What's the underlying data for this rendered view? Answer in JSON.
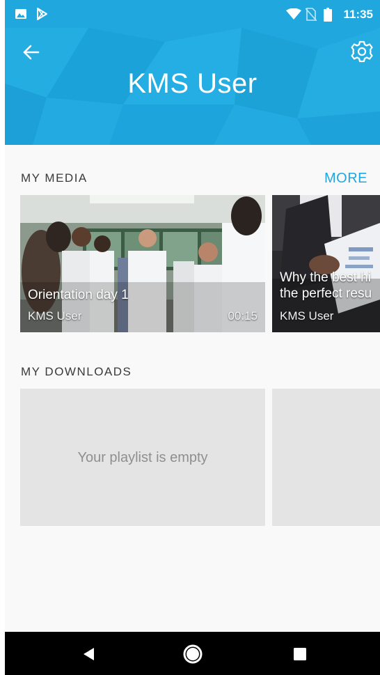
{
  "status_bar": {
    "time": "11:35",
    "left_icons": [
      "image-icon",
      "play-store-icon"
    ],
    "right_icons": [
      "wifi-icon",
      "no-sim-icon",
      "battery-icon"
    ]
  },
  "header": {
    "title": "KMS User",
    "back_icon": "arrow-left-icon",
    "settings_icon": "gear-icon",
    "background_color": "#1fa7de"
  },
  "my_media": {
    "section_title": "MY MEDIA",
    "more_label": "MORE",
    "items": [
      {
        "title": "Orientation day 1",
        "author": "KMS User",
        "duration": "00:15"
      },
      {
        "title_line1": "Why the best hi",
        "title_line2": "the perfect resu",
        "author": "KMS User"
      }
    ]
  },
  "my_downloads": {
    "section_title": "MY DOWNLOADS",
    "empty_message": "Your playlist is empty"
  },
  "nav_bar": {
    "back_icon": "triangle-back-icon",
    "home_icon": "circle-home-icon",
    "recents_icon": "square-recents-icon"
  },
  "colors": {
    "accent": "#1fa7de",
    "content_bg": "#f9f9f9",
    "placeholder_bg": "#e4e4e4"
  }
}
